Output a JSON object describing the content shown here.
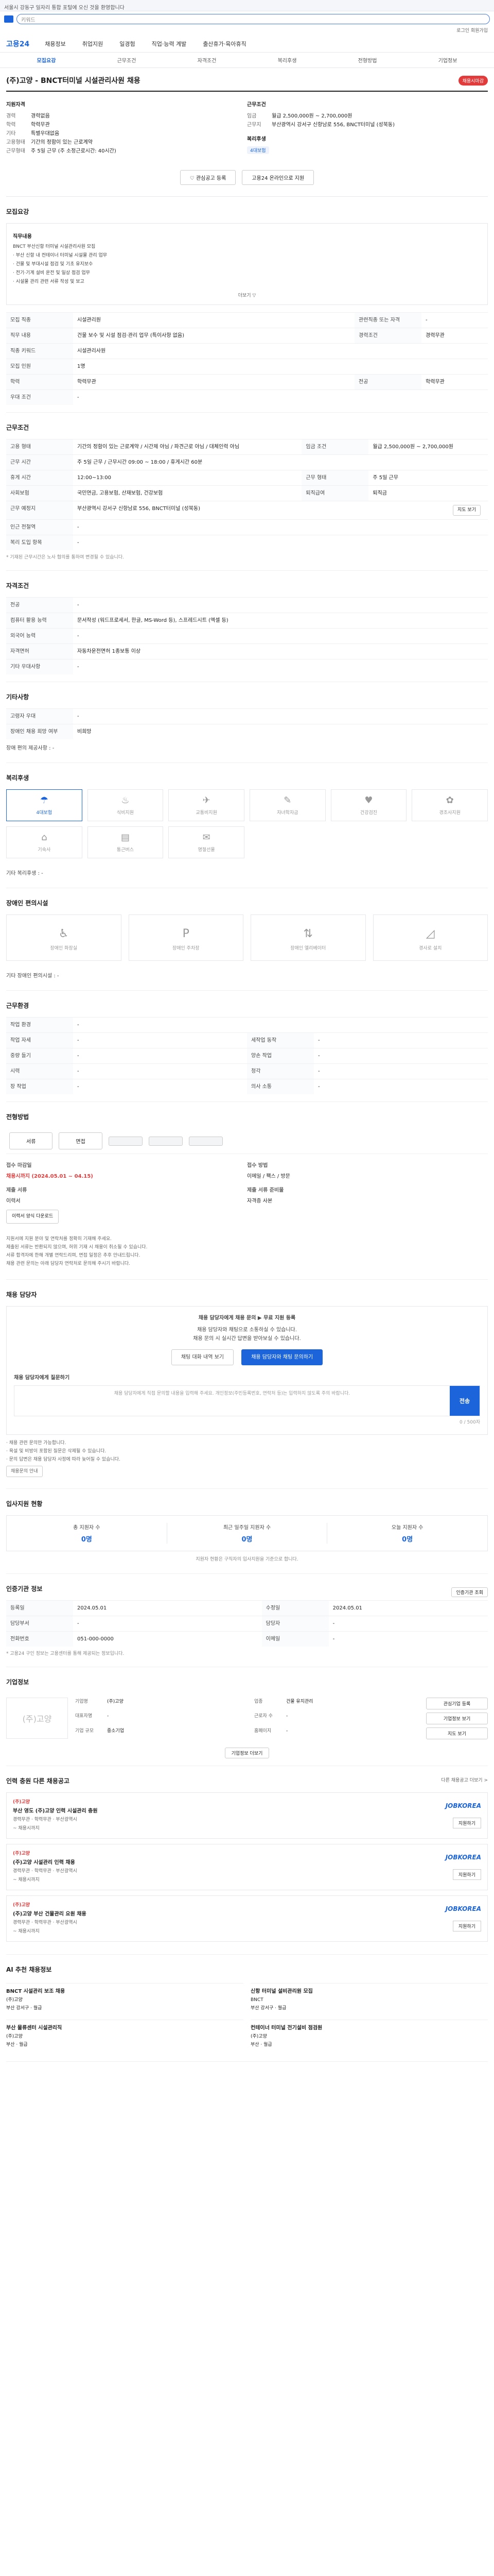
{
  "topbar": {
    "text": "서울시 강동구 일자리 통합 포털에 오신 것을 환영합니다"
  },
  "search": {
    "placeholder": "키워드"
  },
  "util": {
    "links": "로그인  회원가입"
  },
  "brand": {
    "name": "고용24"
  },
  "menu": [
    "채용정보",
    "취업지원",
    "일경험",
    "직업·능력 계발",
    "출산휴가·육아휴직"
  ],
  "tabs": [
    "모집요강",
    "근무조건",
    "자격조건",
    "복리후생",
    "전형방법",
    "기업정보"
  ],
  "job": {
    "title": "(주)고양 - BNCT터미널 시설관리사원 채용",
    "status": "채용시마감",
    "left_title": "지원자격",
    "left_kv": [
      {
        "k": "경력",
        "v": "경력없음"
      },
      {
        "k": "학력",
        "v": "학력무관"
      },
      {
        "k": "기타",
        "v": "특별우대없음"
      },
      {
        "k": "고용형태",
        "v": "기간의 정함이 있는 근로계약"
      },
      {
        "k": "근무형태",
        "v": "주 5일 근무 (주 소정근로시간: 40시간)"
      }
    ],
    "right_title": "근무조건",
    "right_kv": [
      {
        "k": "임금",
        "v": "월급 2,500,000원 ~ 2,700,000원"
      },
      {
        "k": "근무지",
        "v": "부산광역시 강서구 신항남로 556, BNCT터미널 (성북동)"
      }
    ],
    "right_title2": "복리후생",
    "welfare_pill": "4대보험"
  },
  "buttons": {
    "interest": "관심공고 등록",
    "apply_online": "고용24 온라인으로 지원"
  },
  "recruit": {
    "section_title": "모집요강",
    "detail_title": "직무내용",
    "detail_lines": [
      "BNCT 부산신항 터미널 시설관리사원 모집",
      "· 부산 신항 내 컨테이너 터미널 시설물 관리 업무",
      "· 건물 및 부대시설 점검 및 기초 유지보수",
      "· 전기·기계 설비 운전 및 일상 점검 업무",
      "· 시설물 관리 관련 서류 작성 및 보고"
    ],
    "more": "더보기 ▽",
    "rows": [
      {
        "k": "모집 직종",
        "v": "시설관리원",
        "k2": "관련직종 또는 자격",
        "v2": "-"
      },
      {
        "k": "직무 내용",
        "v": "건물 보수 및 시설 점검·관리 업무 (특이사항 없음)",
        "k2": "경력조건",
        "v2": "경력무관"
      },
      {
        "k": "직종 키워드",
        "v": "시설관리사원",
        "k2": "",
        "v2": ""
      },
      {
        "k": "모집 인원",
        "v": "1명",
        "k2": "",
        "v2": ""
      },
      {
        "k": "학력",
        "v": "학력무관",
        "k2": "전공",
        "v2": "학력무관"
      },
      {
        "k": "우대 조건",
        "v": "-",
        "k2": "",
        "v2": ""
      }
    ]
  },
  "work": {
    "section_title": "근무조건",
    "rows": [
      {
        "k": "고용 형태",
        "v": "기간의 정함이 있는 근로계약 / 시간제 아님 / 파견근로 아님 / 대체인력 아님",
        "k2": "임금 조건",
        "v2": "월급 2,500,000원 ~ 2,700,000원"
      },
      {
        "k": "근무 시간",
        "v": "주 5일 근무 / 근무시간 09:00 ~ 18:00 / 휴게시간 60분",
        "k2": "",
        "v2": ""
      },
      {
        "k": "휴게 시간",
        "v": "12:00~13:00",
        "k2": "근무 형태",
        "v2": "주 5일 근무"
      },
      {
        "k": "사회보험",
        "v": "국민연금, 고용보험, 산재보험, 건강보험",
        "k2": "퇴직급여",
        "v2": "퇴직금"
      },
      {
        "k": "근무 예정지",
        "v": "부산광역시 강서구 신항남로 556, BNCT터미널 (성북동)",
        "k2": "",
        "v2": ""
      },
      {
        "k": "인근 전철역",
        "v": "-",
        "k2": "",
        "v2": ""
      },
      {
        "k": "복리 도입 항목",
        "v": "-",
        "k2": "",
        "v2": ""
      }
    ],
    "map_btn": "지도 보기",
    "note": "* 기재된 근무시간은 노사 협의를 통하여 변경될 수 있습니다."
  },
  "qual": {
    "section_title": "자격조건",
    "rows": [
      {
        "k": "전공",
        "v": "-"
      },
      {
        "k": "컴퓨터 활용 능력",
        "v": "문서작성 (워드프로세서, 한글, MS-Word 등), 스프레드시트 (엑셀 등)"
      },
      {
        "k": "외국어 능력",
        "v": "-"
      },
      {
        "k": "자격면허",
        "v": "자동차운전면허 1종보통 이상"
      },
      {
        "k": "기타 우대사항",
        "v": "-"
      }
    ]
  },
  "etc": {
    "section_title": "기타사항",
    "rows": [
      {
        "k": "고령자 우대",
        "v": "-"
      },
      {
        "k": "장애인 채용 희망 여부",
        "v": "비희망"
      }
    ],
    "disability_label": "장애 편의 제공사항",
    "disability_value": "-"
  },
  "welfare": {
    "section_title": "복리후생",
    "icons": [
      {
        "name": "4대보험",
        "glyph": "☂",
        "on": true
      },
      {
        "name": "식비지원",
        "glyph": "♨",
        "on": false
      },
      {
        "name": "교통비지원",
        "glyph": "✈",
        "on": false
      },
      {
        "name": "자녀학자금",
        "glyph": "✎",
        "on": false
      },
      {
        "name": "건강검진",
        "glyph": "♥",
        "on": false
      },
      {
        "name": "경조사지원",
        "glyph": "✿",
        "on": false
      },
      {
        "name": "기숙사",
        "glyph": "⌂",
        "on": false
      },
      {
        "name": "통근버스",
        "glyph": "▤",
        "on": false
      },
      {
        "name": "명절선물",
        "glyph": "✉",
        "on": false
      }
    ],
    "etc_label": "기타 복리후생",
    "etc_value": "-"
  },
  "disabled_support": {
    "section_title": "장애인 편의시설",
    "icons": [
      {
        "name": "장애인 화장실",
        "glyph": "♿"
      },
      {
        "name": "장애인 주차장",
        "glyph": "P"
      },
      {
        "name": "장애인 엘리베이터",
        "glyph": "⇅"
      },
      {
        "name": "경사로 설치",
        "glyph": "◿"
      }
    ],
    "etc_label": "기타 장애인 편의시설",
    "etc_value": "-"
  },
  "worksite": {
    "section_title": "근무환경",
    "rows": [
      {
        "k": "작업 환경",
        "v": "-"
      },
      {
        "k": "작업 자세",
        "v": "-",
        "k2": "세작업 동작",
        "v2": "-"
      },
      {
        "k": "중량 들기",
        "v": "-",
        "k2": "양손 작업",
        "v2": "-"
      },
      {
        "k": "시력",
        "v": "-",
        "k2": "청각",
        "v2": "-"
      },
      {
        "k": "장 작업",
        "v": "-",
        "k2": "의사 소통",
        "v2": "-"
      }
    ]
  },
  "process": {
    "section_title": "전형방법",
    "steps": [
      "서류",
      "면접",
      "",
      "",
      ""
    ],
    "doc_title": "접수 마감일",
    "doc_value": "채용시까지 (2024.05.01 ~ 04.15)",
    "doc_title2": "접수 방법",
    "doc_value2": "이메일 / 팩스 / 방문",
    "method_title": "제출 서류",
    "method_value": "이력서",
    "form_btn": "이력서 양식 다운로드",
    "submit_title": "제출 서류 준비물",
    "submit_value": "자격증 사본",
    "bullets": [
      "지원서에 지원 분야 및 연락처를 정확히 기재해 주세요.",
      "제출된 서류는 반환되지 않으며, 허위 기재 시 채용이 취소될 수 있습니다.",
      "서류 합격자에 한해 개별 연락드리며, 면접 일정은 추후 안내드립니다.",
      "채용 관련 문의는 아래 담당자 연락처로 문의해 주시기 바랍니다."
    ]
  },
  "qa": {
    "section_title": "채용 담당자",
    "headline": "채용 담당자에게 채용 문의 ▶ 무료 지원 등록",
    "line1": "채용 담당자와 채팅으로 소통하실 수 있습니다.",
    "line2": "채용 문의 시 실시간 답변을 받아보실 수 있습니다.",
    "btn1": "채팅 대화 내역 보기",
    "btn2": "채용 담당자와 채팅 문의하기",
    "input_label": "채용 담당자에게 질문하기",
    "input_placeholder": "채용 담당자에게 직접 문의할 내용을 입력해 주세요. 개인정보(주민등록번호, 연락처 등)는 입력하지 않도록 주의 바랍니다.",
    "send": "전송",
    "counter": "0 / 500자",
    "notes": [
      "· 채용 관련 문의만 가능합니다.",
      "· 욕설 및 비방이 포함된 질문은 삭제될 수 있습니다.",
      "· 문의 답변은 채용 담당자 사정에 따라 늦어질 수 있습니다."
    ],
    "notes_btn": "채용문의 안내"
  },
  "status": {
    "section_title": "입사지원 현황",
    "stats": [
      {
        "label": "총 지원자 수",
        "n": "0명"
      },
      {
        "label": "최근 일주일 지원자 수",
        "n": "0명"
      },
      {
        "label": "오늘 지원자 수",
        "n": "0명"
      }
    ],
    "note": "지원자 현황은 구직자의 입사지원을 기준으로 합니다."
  },
  "info": {
    "section_title": "인증기관 정보",
    "print": "인증기관 조회",
    "rows": [
      {
        "k": "등록일",
        "v": "2024.05.01",
        "k2": "수정일",
        "v2": "2024.05.01"
      },
      {
        "k": "담당부서",
        "v": "-",
        "k2": "담당자",
        "v2": "-"
      },
      {
        "k": "전화번호",
        "v": "051-000-0000",
        "k2": "이메일",
        "v2": "-"
      }
    ],
    "note": "* 고용24 구인 정보는 고용센터를 통해 제공되는 정보입니다."
  },
  "company": {
    "section_title": "기업정보",
    "logo": "(주)고양",
    "info": [
      {
        "k": "기업명",
        "v": "(주)고양"
      },
      {
        "k": "업종",
        "v": "건물 유지관리"
      },
      {
        "k": "대표자명",
        "v": "-"
      },
      {
        "k": "근로자 수",
        "v": "-"
      },
      {
        "k": "기업 규모",
        "v": "중소기업"
      },
      {
        "k": "홈페이지",
        "v": "-"
      }
    ],
    "btn1": "관심기업 등록",
    "btn2": "기업정보 보기",
    "map_btn": "지도 보기",
    "view_btn": "기업정보 더보기"
  },
  "same_company": {
    "section_title": "인력 충원 다른 채용공고",
    "more": "다른 채용공고 더보기 >",
    "items": [
      {
        "company": "(주)고양",
        "title": "부산 영도 (주)고양 인력 시설관리 충원",
        "meta": "경력무관 · 학력무관 · 부산광역시",
        "date": "~ 채용시까지",
        "logo": "JOBKOREA",
        "btn": "지원하기"
      },
      {
        "company": "(주)고양",
        "title": "(주)고양 시설관리 인력 채용",
        "meta": "경력무관 · 학력무관 · 부산광역시",
        "date": "~ 채용시까지",
        "logo": "JOBKOREA",
        "btn": "지원하기"
      },
      {
        "company": "(주)고양",
        "title": "(주)고양 부산 건물관리 요원 채용",
        "meta": "경력무관 · 학력무관 · 부산광역시",
        "date": "~ 채용시까지",
        "logo": "JOBKOREA",
        "btn": "지원하기"
      }
    ]
  },
  "recommend": {
    "section_title": "AI 추천 채용정보",
    "items": [
      {
        "title": "BNCT 시설관리 보조 채용",
        "company": "(주)고양",
        "meta": "부산 강서구 · 월급"
      },
      {
        "title": "신항 터미널 설비관리원 모집",
        "company": "BNCT",
        "meta": "부산 강서구 · 월급"
      },
      {
        "title": "부산 물류센터 시설관리직",
        "company": "(주)고양",
        "meta": "부산 · 월급"
      },
      {
        "title": "컨테이너 터미널 전기설비 점검원",
        "company": "(주)고양",
        "meta": "부산 · 월급"
      }
    ]
  }
}
